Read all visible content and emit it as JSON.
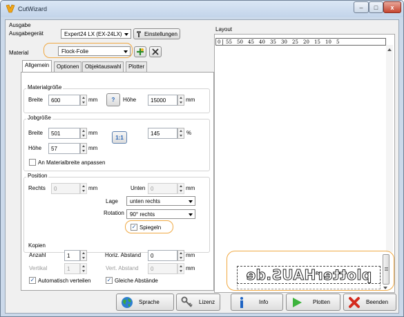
{
  "window": {
    "title": "CutWizard",
    "min": "–",
    "max": "□",
    "close": "x"
  },
  "ausgabe": {
    "group_title": "Ausgabe",
    "geraet_label": "Ausgabegerät",
    "geraet_value": "Expert24 LX (EX-24LX)",
    "einstellungen": "Einstellungen",
    "material_label": "Material",
    "material_value": "Flock-Folie"
  },
  "tabs": [
    "Allgemein",
    "Optionen",
    "Objektauswahl",
    "Plotter"
  ],
  "materialgroesse": {
    "title": "Materialgröße",
    "breite_label": "Breite",
    "breite_value": "600",
    "breite_unit": "mm",
    "swap_label": "?",
    "hoehe_label": "Höhe",
    "hoehe_value": "15000",
    "hoehe_unit": "mm"
  },
  "jobgroesse": {
    "title": "Jobgröße",
    "breite_label": "Breite",
    "breite_value": "501",
    "breite_unit": "mm",
    "hoehe_label": "Höhe",
    "hoehe_value": "57",
    "hoehe_unit": "mm",
    "ratio_label": "1:1",
    "percent_value": "145",
    "percent_unit": "%",
    "anpassen_label": "An Materialbreite anpassen"
  },
  "position": {
    "title": "Position",
    "rechts_label": "Rechts",
    "rechts_value": "0",
    "rechts_unit": "mm",
    "unten_label": "Unten",
    "unten_value": "0",
    "unten_unit": "mm",
    "lage_label": "Lage",
    "lage_value": "unten rechts",
    "rotation_label": "Rotation",
    "rotation_value": "90° rechts",
    "spiegeln_label": "Spiegeln"
  },
  "kopien": {
    "title": "Kopien",
    "anzahl_label": "Anzahl",
    "anzahl_value": "1",
    "vertikal_label": "Vertikal",
    "vertikal_value": "1",
    "horiz_label": "Horiz. Abstand",
    "horiz_value": "0",
    "horiz_unit": "mm",
    "vert_label": "Vert. Abstand",
    "vert_value": "0",
    "vert_unit": "mm",
    "auto_label": "Automatisch verteilen",
    "gleiche_label": "Gleiche Abstände"
  },
  "layout": {
    "title": "Layout",
    "ruler_left": "0",
    "ruler": [
      "55",
      "50",
      "45",
      "40",
      "35",
      "30",
      "25",
      "20",
      "15",
      "10",
      "5"
    ],
    "preview_text": "plotterHAUS.de"
  },
  "buttons": {
    "sprache": "Sprache",
    "lizenz": "Lizenz",
    "info": "Info",
    "plotten": "Plotten",
    "beenden": "Beenden"
  },
  "colors": {
    "highlight": "#f0a841",
    "title_bar": "#c3d4ea"
  }
}
